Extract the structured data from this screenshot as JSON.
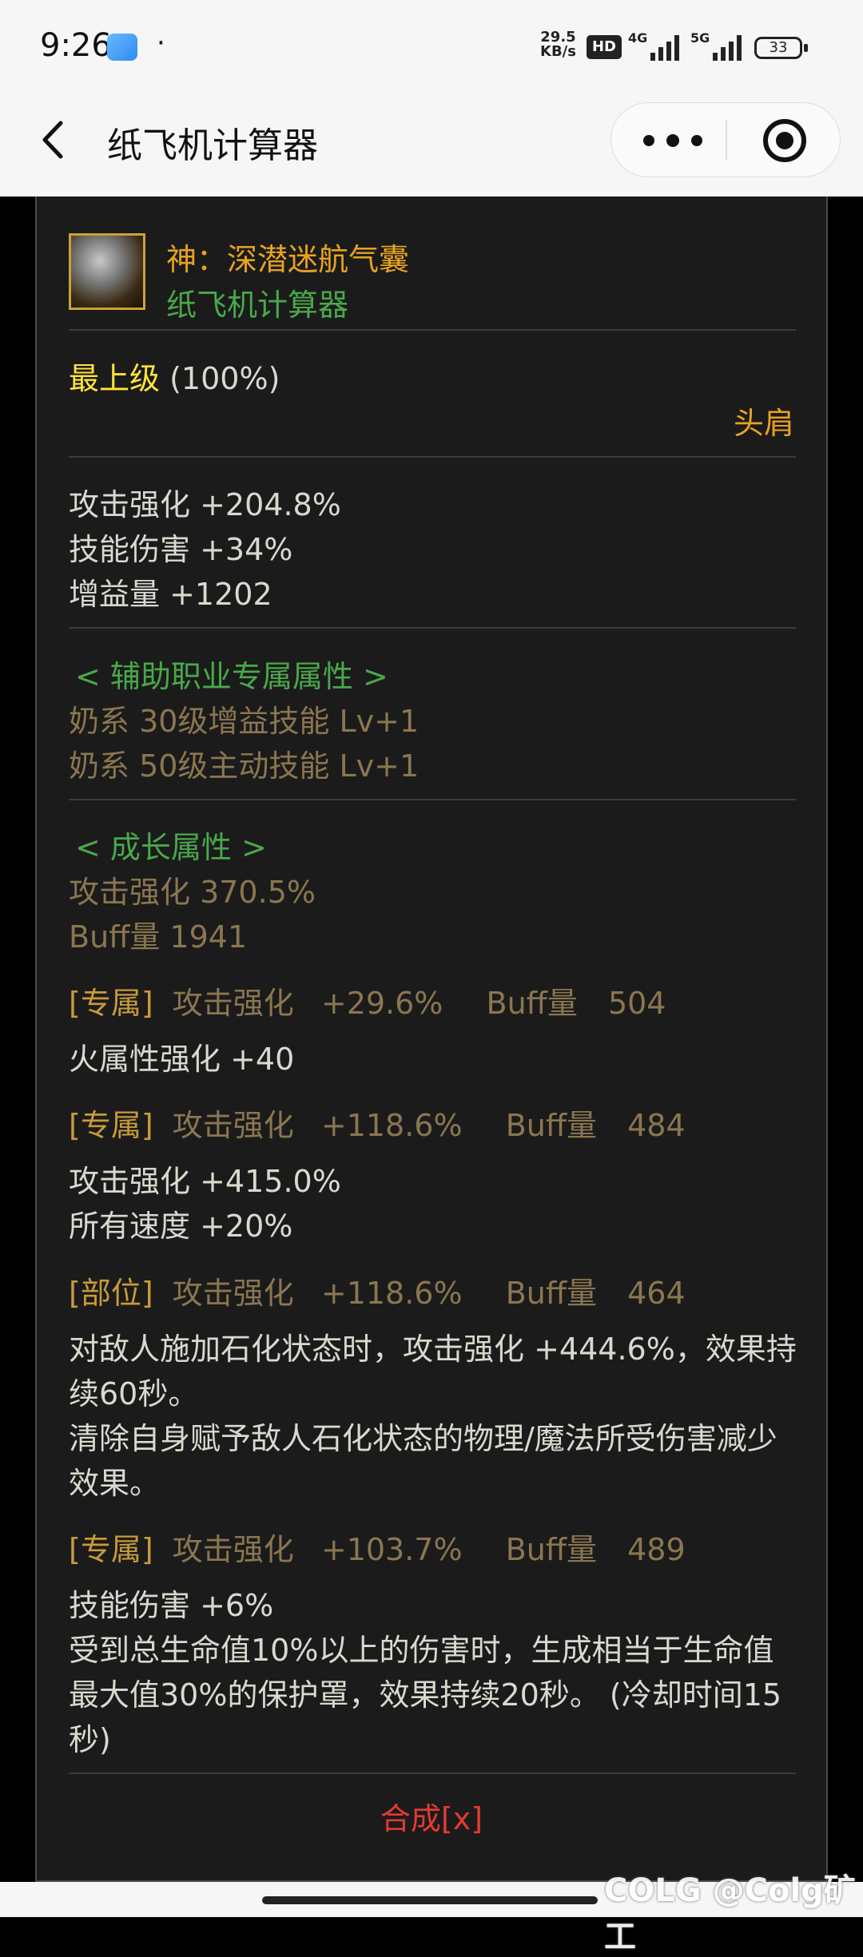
{
  "status": {
    "time": "9:26",
    "netspeed_value": "29.5",
    "netspeed_unit": "KB/s",
    "hd": "HD",
    "sig1": "4G",
    "sig2": "5G",
    "battery": "33"
  },
  "header": {
    "title": "纸飞机计算器"
  },
  "item": {
    "name": "神：深潜迷航气囊",
    "source": "纸飞机计算器",
    "grade": "最上级",
    "grade_pct": "(100%)",
    "slot": "头肩"
  },
  "base_stats": [
    "攻击强化 +204.8%",
    "技能伤害 +34%",
    "增益量 +1202"
  ],
  "support": {
    "header": "< 辅助职业专属属性 >",
    "lines": [
      "奶系 30级增益技能 Lv+1",
      "奶系 50级主动技能 Lv+1"
    ]
  },
  "growth": {
    "header": "< 成长属性 >",
    "lines": [
      "攻击强化 370.5%",
      "Buff量 1941"
    ]
  },
  "options": [
    {
      "tag": "[专属]",
      "atk_label": "攻击强化",
      "atk_value": "+29.6%",
      "buff_label": "Buff量",
      "buff_value": "504",
      "effects": [
        "火属性强化 +40"
      ]
    },
    {
      "tag": "[专属]",
      "atk_label": "攻击强化",
      "atk_value": "+118.6%",
      "buff_label": "Buff量",
      "buff_value": "484",
      "effects": [
        "攻击强化 +415.0%",
        "所有速度 +20%"
      ]
    },
    {
      "tag": "[部位]",
      "atk_label": "攻击强化",
      "atk_value": "+118.6%",
      "buff_label": "Buff量",
      "buff_value": "464",
      "effects": [
        "对敌人施加石化状态时，攻击强化 +444.6%，效果持",
        "续60秒。",
        "清除自身赋予敌人石化状态的物理/魔法所受伤害减少",
        "效果。"
      ]
    },
    {
      "tag": "[专属]",
      "atk_label": "攻击强化",
      "atk_value": "+103.7%",
      "buff_label": "Buff量",
      "buff_value": "489",
      "effects": [
        "技能伤害 +6%",
        "受到总生命值10%以上的伤害时，生成相当于生命值",
        "最大值30%的保护罩，效果持续20秒。 (冷却时间15",
        "秒)"
      ]
    }
  ],
  "synth": "合成[x]",
  "watermark": "COLG @Colg矿工"
}
